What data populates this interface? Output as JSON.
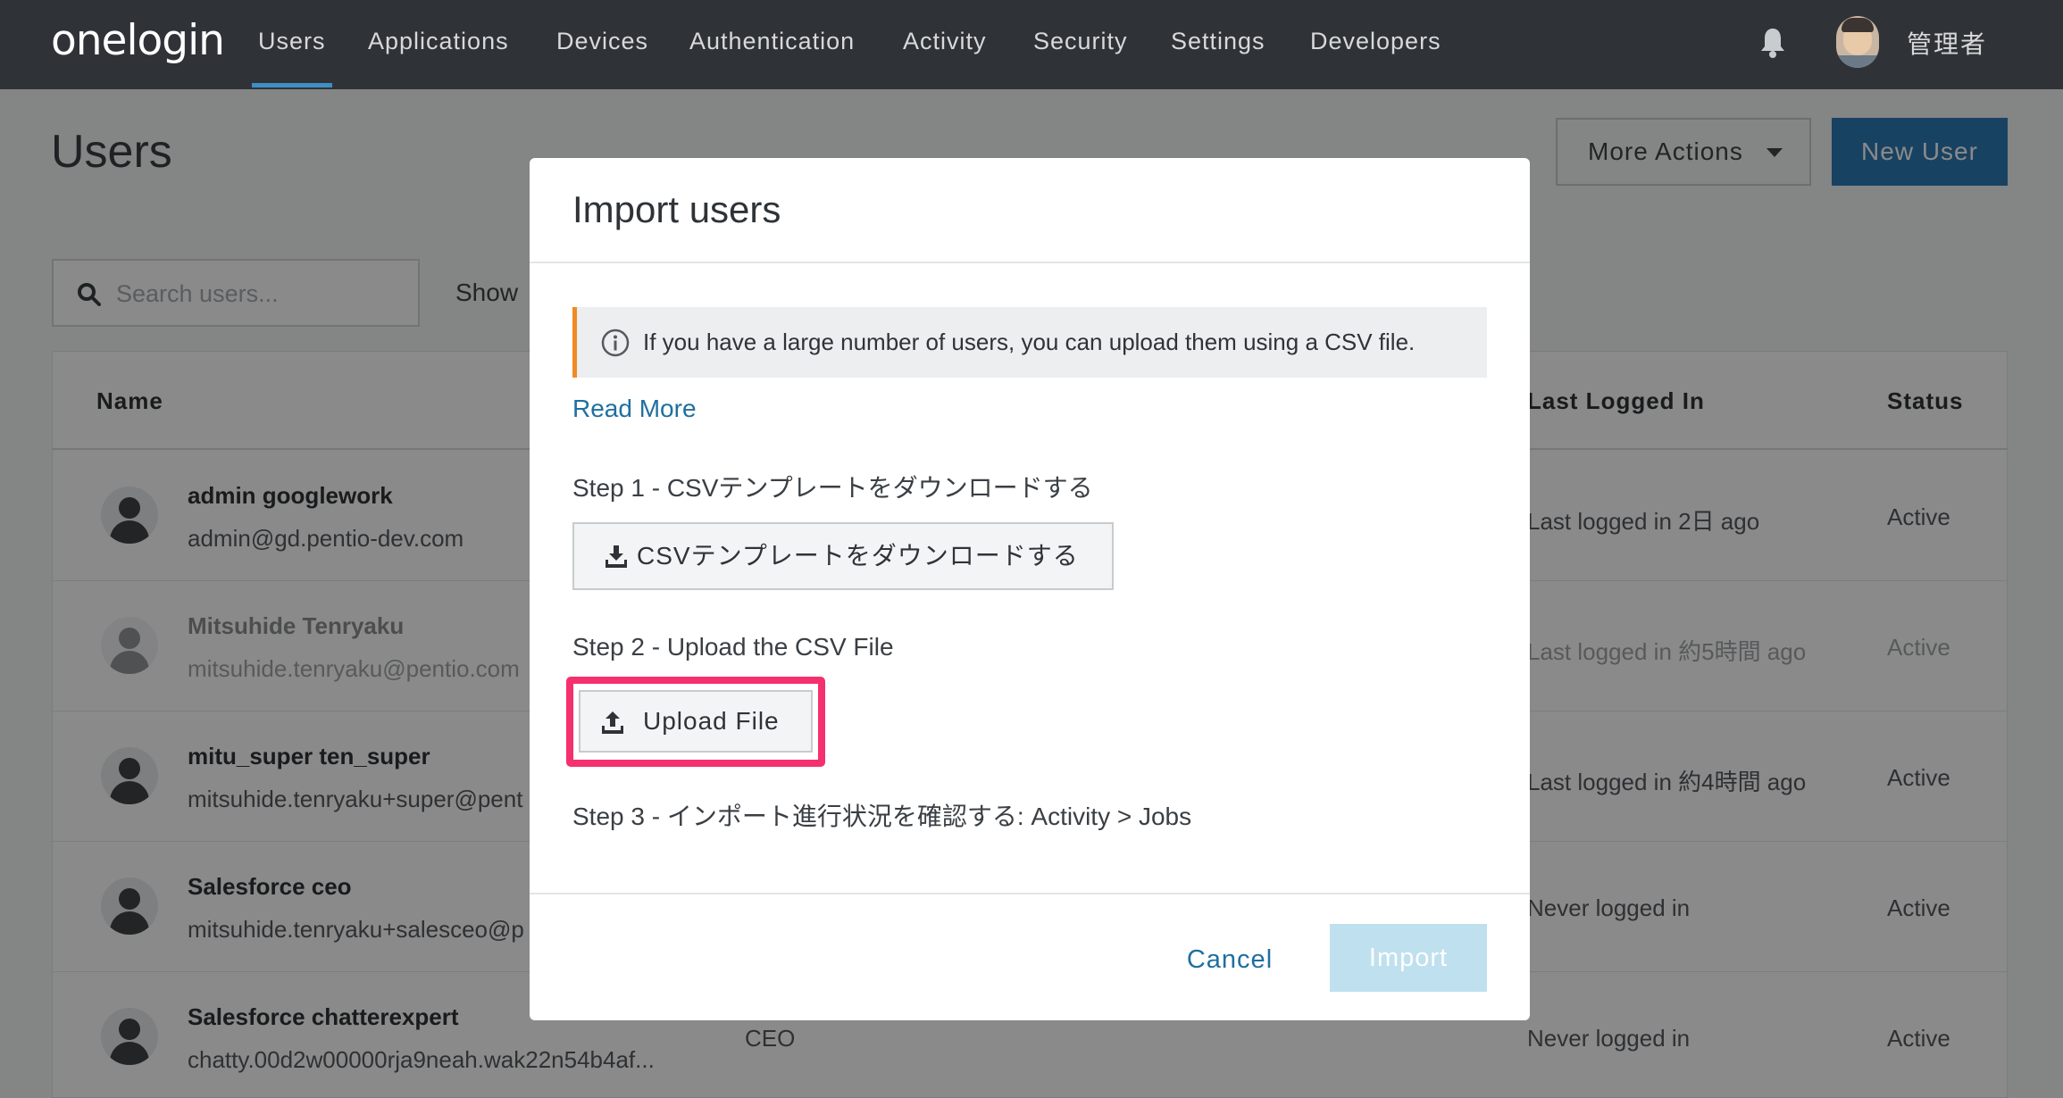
{
  "nav": {
    "logo": "onelogin",
    "items": [
      "Users",
      "Applications",
      "Devices",
      "Authentication",
      "Activity",
      "Security",
      "Settings",
      "Developers"
    ],
    "admin_name": "管理者",
    "active_color": "#3d8fc6"
  },
  "page": {
    "title": "Users",
    "more_actions": "More Actions",
    "new_user": "New User",
    "search_placeholder": "Search users...",
    "show_label": "Show"
  },
  "table": {
    "headers": {
      "name": "Name",
      "last_logged_in": "Last Logged In",
      "status": "Status"
    },
    "rows": [
      {
        "name": "admin googlework",
        "email": "admin@gd.pentio-dev.com",
        "title": "",
        "last_login": "Last logged in 2日 ago",
        "status": "Active"
      },
      {
        "name": "Mitsuhide Tenryaku",
        "email": "mitsuhide.tenryaku@pentio.com",
        "title": "",
        "last_login": "Last logged in 約5時間 ago",
        "status": "Active"
      },
      {
        "name": "mitu_super ten_super",
        "email": "mitsuhide.tenryaku+super@pent",
        "title": "",
        "last_login": "Last logged in 約4時間 ago",
        "status": "Active"
      },
      {
        "name": "Salesforce ceo",
        "email": "mitsuhide.tenryaku+salesceo@p",
        "title": "",
        "last_login": "Never logged in",
        "status": "Active"
      },
      {
        "name": "Salesforce chatterexpert",
        "email": "chatty.00d2w00000rja9neah.wak22n54b4af...",
        "title": "CEO",
        "last_login": "Never logged in",
        "status": "Active"
      }
    ]
  },
  "modal": {
    "title": "Import users",
    "info_text": "If you have a large number of users, you can upload them using a CSV file.",
    "read_more": "Read More",
    "step1": "Step 1 - CSVテンプレートをダウンロードする",
    "download_button": "CSVテンプレートをダウンロードする",
    "step2": "Step 2 - Upload the CSV File",
    "upload_button": "Upload File",
    "step3": "Step 3 - インポート進行状況を確認する: Activity > Jobs",
    "cancel": "Cancel",
    "import": "Import",
    "info_accent": "#f08a24",
    "highlight_color": "#f5306e"
  }
}
